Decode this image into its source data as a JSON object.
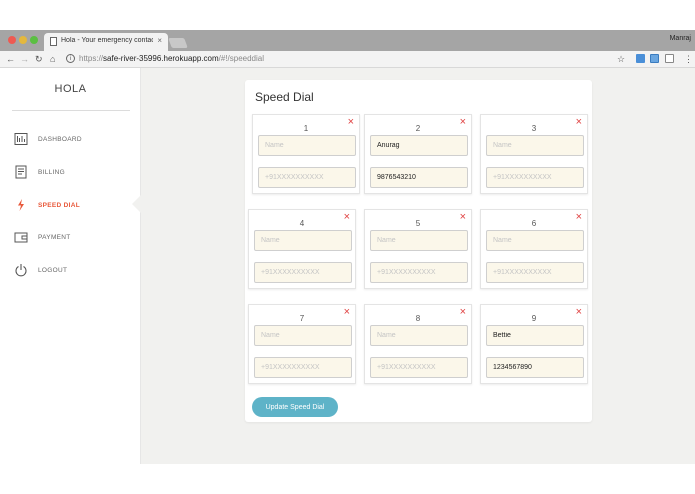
{
  "browser": {
    "tab_title": "Hola - Your emergency contac",
    "tab_close": "×",
    "profile_name": "Manraj",
    "url_scheme": "https://",
    "url_host": "safe-river-35996.herokuapp.com",
    "url_path": "/#!/speeddial",
    "icons": [
      "back-icon",
      "forward-icon",
      "reload-icon",
      "home-icon",
      "info-icon",
      "star-icon",
      "menu-icon"
    ]
  },
  "sidebar": {
    "brand": "HOLA",
    "items": [
      {
        "label": "DASHBOARD",
        "icon": "dashboard-icon",
        "active": false
      },
      {
        "label": "BILLING",
        "icon": "billing-icon",
        "active": false
      },
      {
        "label": "SPEED DIAL",
        "icon": "lightning-icon",
        "active": true
      },
      {
        "label": "PAYMENT",
        "icon": "wallet-icon",
        "active": false
      },
      {
        "label": "LOGOUT",
        "icon": "power-icon",
        "active": false
      }
    ]
  },
  "main": {
    "title": "Speed Dial",
    "remove_glyph": "×",
    "name_placeholder": "Name",
    "phone_placeholder": "+91XXXXXXXXXX",
    "cards": [
      {
        "num": "1",
        "name": "",
        "phone": ""
      },
      {
        "num": "2",
        "name": "Anurag",
        "phone": "9876543210"
      },
      {
        "num": "3",
        "name": "",
        "phone": ""
      },
      {
        "num": "4",
        "name": "",
        "phone": ""
      },
      {
        "num": "5",
        "name": "",
        "phone": ""
      },
      {
        "num": "6",
        "name": "",
        "phone": ""
      },
      {
        "num": "7",
        "name": "",
        "phone": ""
      },
      {
        "num": "8",
        "name": "",
        "phone": ""
      },
      {
        "num": "9",
        "name": "Bettie",
        "phone": "1234567890"
      }
    ],
    "update_label": "Update Speed Dial"
  },
  "colors": {
    "accent": "#e8583a",
    "button": "#5eb3c8",
    "remove": "#e04040",
    "field_bg": "#fbf7ea"
  }
}
